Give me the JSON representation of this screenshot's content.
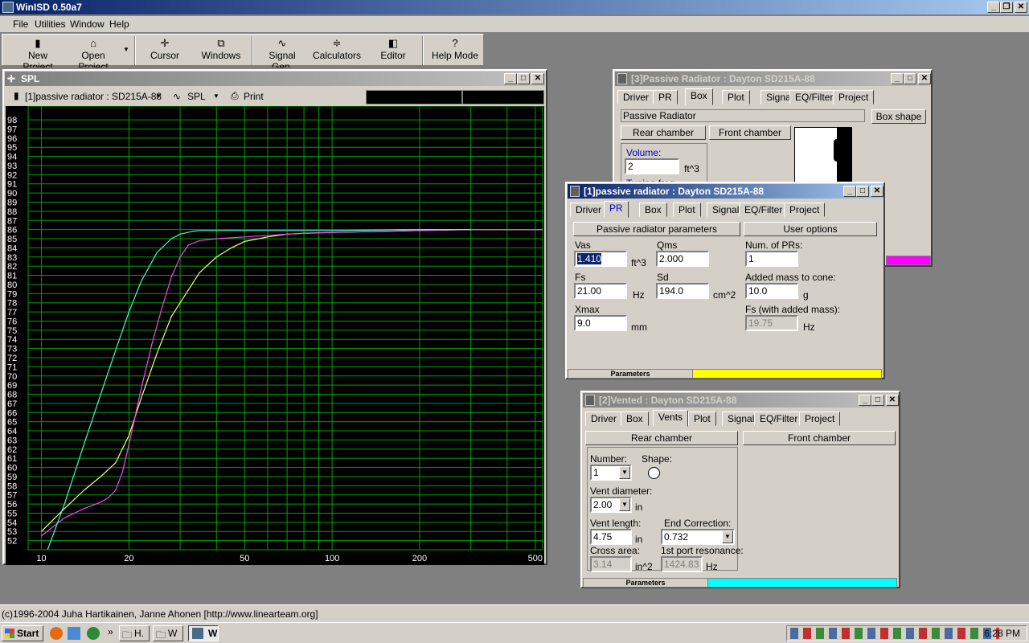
{
  "app": {
    "title": "WinISD 0.50a7"
  },
  "menu": [
    "File",
    "Utilities",
    "Window",
    "Help"
  ],
  "toolbar": {
    "new_project": "New Project",
    "open_project": "Open Project",
    "cursor": "Cursor",
    "windows": "Windows",
    "signal_gen": "Signal Gen.",
    "calculators": "Calculators",
    "editor": "Editor",
    "help_mode": "Help Mode"
  },
  "spl_window": {
    "title": "SPL",
    "project_select": "[1]passive radiator : SD215A-88",
    "plot_select": "SPL",
    "print": "Print"
  },
  "chart_data": {
    "type": "line",
    "x_scale": "log",
    "xlim": [
      9,
      530
    ],
    "ylim": [
      51,
      99.5
    ],
    "x_ticks": [
      "10",
      "20",
      "50",
      "100",
      "200",
      "500"
    ],
    "y_ticks": [
      "52",
      "53",
      "54",
      "55",
      "56",
      "57",
      "58",
      "59",
      "60",
      "61",
      "62",
      "63",
      "64",
      "65",
      "66",
      "67",
      "68",
      "69",
      "70",
      "71",
      "72",
      "73",
      "74",
      "75",
      "76",
      "77",
      "78",
      "79",
      "80",
      "81",
      "82",
      "83",
      "84",
      "85",
      "86",
      "87",
      "88",
      "89",
      "90",
      "91",
      "92",
      "93",
      "94",
      "95",
      "96",
      "97",
      "98"
    ],
    "grid": true,
    "background": "#000000",
    "grid_color": "#00a000",
    "series": [
      {
        "color": "#ffff80",
        "x": [
          10,
          12,
          14,
          16,
          18,
          20,
          22,
          25,
          28,
          30,
          35,
          40,
          45,
          50,
          60,
          70,
          80,
          100,
          150,
          200,
          300,
          530
        ],
        "y": [
          53,
          55.5,
          57.5,
          59,
          60.5,
          63.5,
          67.5,
          72.5,
          76.5,
          78,
          81.3,
          83,
          84,
          84.7,
          85.2,
          85.5,
          85.6,
          85.7,
          85.8,
          85.9,
          86,
          86
        ]
      },
      {
        "color": "#ff40ff",
        "x": [
          10,
          12,
          14,
          16,
          17,
          18,
          19,
          20,
          22,
          24,
          26,
          28,
          30,
          32,
          35,
          40,
          50,
          70,
          100,
          200,
          300,
          530
        ],
        "y": [
          52.5,
          54.5,
          55.5,
          56.2,
          56.7,
          57.5,
          59.5,
          62.5,
          68.5,
          73.5,
          77.5,
          80.8,
          83,
          84.3,
          84.8,
          85,
          85.2,
          85.5,
          85.7,
          85.9,
          86,
          86
        ]
      },
      {
        "color": "#40ffd0",
        "x": [
          10.5,
          12,
          14,
          16,
          18,
          20,
          22,
          25,
          28,
          30,
          33,
          35,
          40,
          50,
          70,
          100,
          200,
          300
        ],
        "y": [
          51,
          56,
          62.5,
          68,
          72.8,
          77,
          80.3,
          83.5,
          85,
          85.5,
          85.8,
          85.9,
          85.9,
          85.9,
          85.9,
          85.9,
          86,
          86
        ]
      }
    ]
  },
  "pr_box_window": {
    "title": "[3]Passive Radiator : Dayton SD215A-88",
    "tabs": [
      "Driver",
      "PR",
      "Box",
      "Plot",
      "Signal",
      "EQ/Filter",
      "Project"
    ],
    "box_type": "Passive Radiator",
    "box_shape_btn": "Box shape",
    "rear_chamber": "Rear chamber",
    "front_chamber": "Front chamber",
    "volume_label": "Volume:",
    "volume_value": "2",
    "volume_unit": "ft^3",
    "tuning_label": "Tuning freq.",
    "color": "#ff00ff"
  },
  "pr_window": {
    "title": "[1]passive radiator : Dayton SD215A-88",
    "tabs": [
      "Driver",
      "PR",
      "Box",
      "Plot",
      "Signal",
      "EQ/Filter",
      "Project"
    ],
    "section_params": "Passive radiator parameters",
    "section_user": "User options",
    "vas_label": "Vas",
    "vas_value": "1.410",
    "vas_unit": "ft^3",
    "qms_label": "Qms",
    "qms_value": "2.000",
    "fs_label": "Fs",
    "fs_value": "21.00",
    "fs_unit": "Hz",
    "sd_label": "Sd",
    "sd_value": "194.0",
    "sd_unit": "cm^2",
    "xmax_label": "Xmax",
    "xmax_value": "9.0",
    "xmax_unit": "mm",
    "num_prs_label": "Num. of PRs:",
    "num_prs_value": "1",
    "added_mass_label": "Added mass to cone:",
    "added_mass_value": "10.0",
    "added_mass_unit": "g",
    "fs_added_label": "Fs (with added mass):",
    "fs_added_value": "19.75",
    "fs_added_unit": "Hz",
    "footer": "Parameters",
    "color": "#ffff00"
  },
  "vented_window": {
    "title": "[2]Vented : Dayton SD215A-88",
    "tabs": [
      "Driver",
      "Box",
      "Vents",
      "Plot",
      "Signal",
      "EQ/Filter",
      "Project"
    ],
    "rear_chamber": "Rear chamber",
    "front_chamber": "Front chamber",
    "number_label": "Number:",
    "number_value": "1",
    "shape_label": "Shape:",
    "diameter_label": "Vent diameter:",
    "diameter_value": "2.00",
    "diameter_unit": "in",
    "length_label": "Vent length:",
    "length_value": "4.75",
    "length_unit": "in",
    "end_corr_label": "End Correction:",
    "end_corr_value": "0.732",
    "cross_area_label": "Cross area:",
    "cross_area_value": "3.14",
    "cross_area_unit": "in^2",
    "port_res_label": "1st port resonance:",
    "port_res_value": "1424.83",
    "port_res_unit": "Hz",
    "footer": "Parameters",
    "color": "#00ffff"
  },
  "status": {
    "text": "(c)1996-2004 Juha Hartikainen, Janne Ahonen [http://www.linearteam.org]"
  },
  "taskbar": {
    "start": "Start",
    "task1": "H.",
    "task2": "W",
    "task3": "W",
    "clock": "6:28 PM"
  }
}
